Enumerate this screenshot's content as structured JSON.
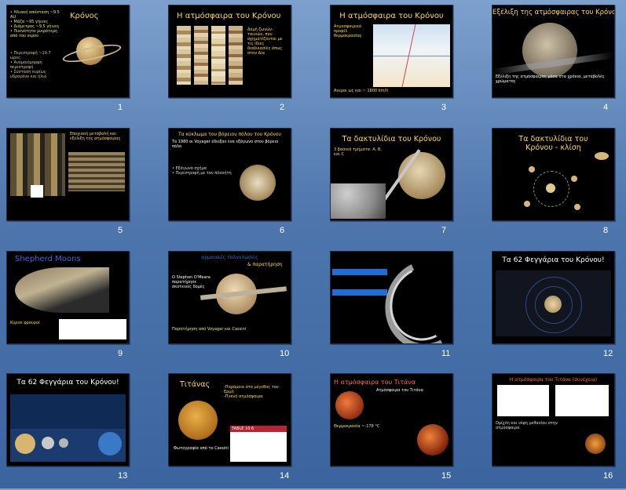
{
  "slides": [
    {
      "number": "1",
      "title": "Κρόνος"
    },
    {
      "number": "2",
      "title": "Η ατμόσφαιρα του Κρόνου"
    },
    {
      "number": "3",
      "title": "Η ατμόσφαιρα του Κρόνου"
    },
    {
      "number": "4",
      "title": "Εξέλιξη της ατμόσφαιρας του Κρόνου"
    },
    {
      "number": "5",
      "title": ""
    },
    {
      "number": "6",
      "title": "Τα κύκλωμα του βόρειου πόλου του Κρόνου"
    },
    {
      "number": "7",
      "title": "Τα δακτυλίδια του Κρόνου"
    },
    {
      "number": "8",
      "title": "Τα δακτυλίδια του Κρόνου - κλίση"
    },
    {
      "number": "9",
      "title": "Shepherd Moons"
    },
    {
      "number": "10",
      "title": ""
    },
    {
      "number": "11",
      "title": ""
    },
    {
      "number": "12",
      "title": "Τα 62 Φεγγάρια του Κρόνου!"
    },
    {
      "number": "13",
      "title": "Τα 62 Φεγγάρια του Κρόνου!"
    },
    {
      "number": "14",
      "title": "Τιτάνας"
    },
    {
      "number": "15",
      "title": "Η ατμόσφαιρα του Τιτάνα"
    },
    {
      "number": "16",
      "title": ""
    }
  ],
  "slide_texts": {
    "s1_body": "Ηλιακή απόσταση, μάζα, διάμετρος, σύσταση",
    "s2_body": "Δομή ζωνών-ταινιών, που σχηματίζονται με τις ίδιες διαδικασίες όπως στον Δία",
    "s3_body": "Ατμοσφαιρικό προφίλ θερμοκρασίας",
    "s7_body": "3 βασικά τμήματα: A, B, και C",
    "s9_body": "Κύριοι φρουροί",
    "s10_highlight": "& παρατήρηση",
    "s10_link": "αρμονικές ταλαντώσεις",
    "s14_caption": "Φωτογραφία από το Cassini",
    "s14_table_header": "TABLE 10.6",
    "s15_body": "Ατμόσφαιρα του Τιτάνα",
    "s16_title": "Η ατμόσφαιρα του Τιτάνα (συνέχεια)"
  }
}
